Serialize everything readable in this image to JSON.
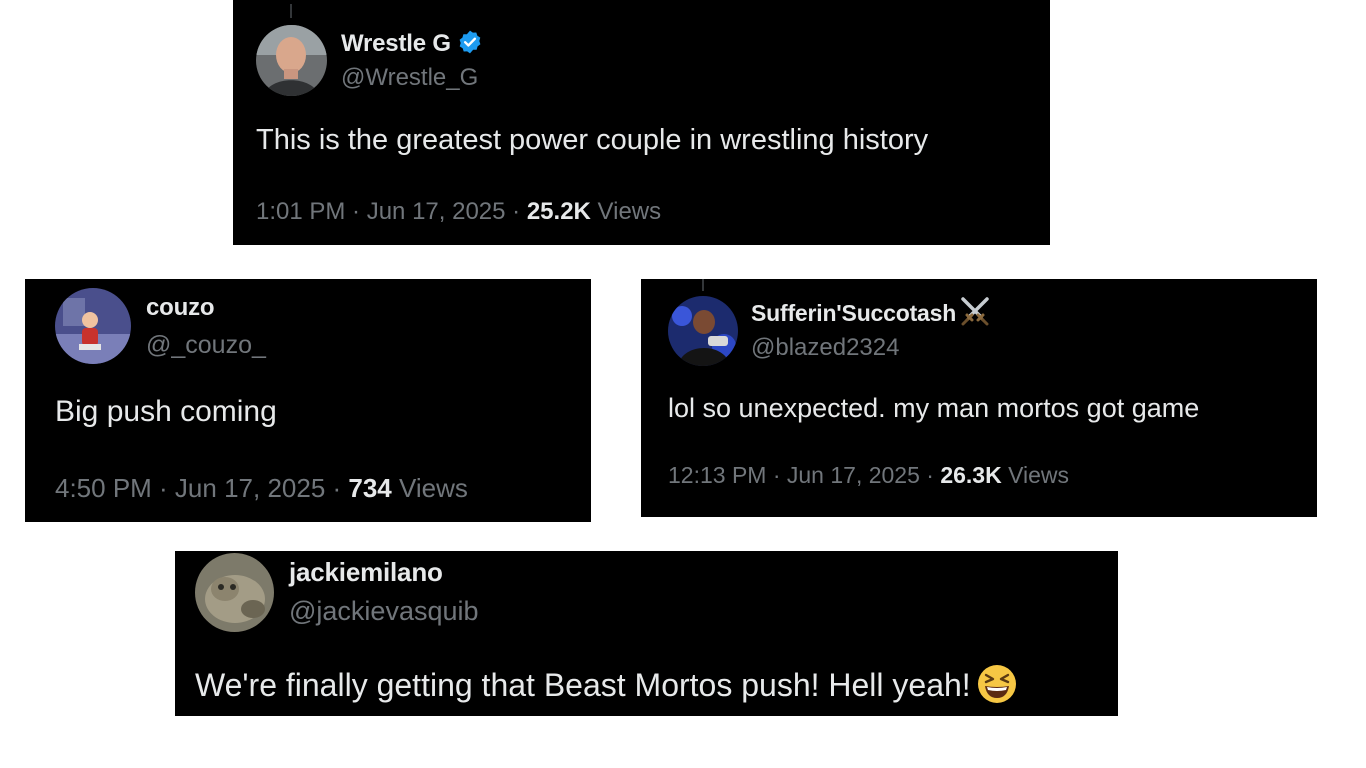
{
  "tweets": [
    {
      "name": "Wrestle G",
      "verified": true,
      "handle": "@Wrestle_G",
      "text": "This is the greatest power couple in wrestling history",
      "time": "1:01 PM · Jun 17, 2025 · ",
      "views_count": "25.2K",
      "views_label": " Views"
    },
    {
      "name": "couzo",
      "handle": "@_couzo_",
      "text": "Big push coming",
      "time": "4:50 PM · Jun 17, 2025 · ",
      "views_count": "734",
      "views_label": " Views"
    },
    {
      "name": "Sufferin'Succotash",
      "name_icon": "crossed-swords-icon",
      "handle": "@blazed2324",
      "text": "lol so unexpected. my man mortos got game",
      "time": "12:13 PM · Jun 17, 2025 · ",
      "views_count": "26.3K",
      "views_label": " Views"
    },
    {
      "name": "jackiemilano",
      "handle": "@jackievasquib",
      "text": "We're finally getting that Beast Mortos push! Hell yeah!",
      "text_icon": "grinning-squinting-face-icon"
    }
  ],
  "colors": {
    "background": "#000000",
    "primary_text": "#e7e9ea",
    "secondary_text": "#71767b",
    "verified_blue": "#1d9bf0"
  }
}
